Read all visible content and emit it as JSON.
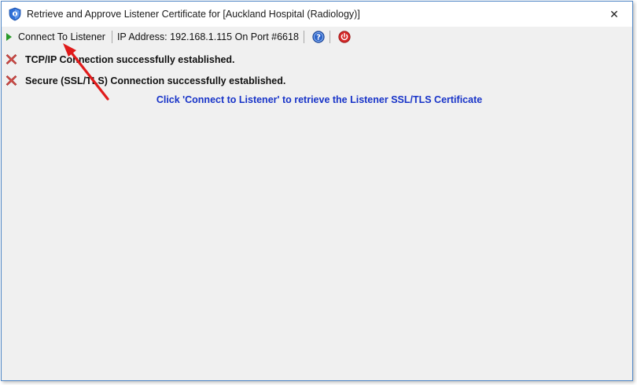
{
  "window": {
    "title": "Retrieve and Approve Listener Certificate for [Auckland Hospital (Radiology)]",
    "close_glyph": "✕"
  },
  "toolbar": {
    "connect_label": "Connect To Listener",
    "ip_info": "IP Address: 192.168.1.115 On Port #6618",
    "help_icon": "help-icon",
    "power_icon": "power-icon"
  },
  "status": [
    {
      "icon": "error-x-icon",
      "text": "TCP/IP Connection successfully established."
    },
    {
      "icon": "error-x-icon",
      "text": "Secure (SSL/TLS)  Connection successfully established."
    }
  ],
  "instruction": "Click 'Connect to Listener' to retrieve the Listener SSL/TLS Certificate",
  "colors": {
    "instruction": "#1733c8",
    "annotation_arrow": "#e01b1b",
    "play": "#2a9a2a"
  }
}
